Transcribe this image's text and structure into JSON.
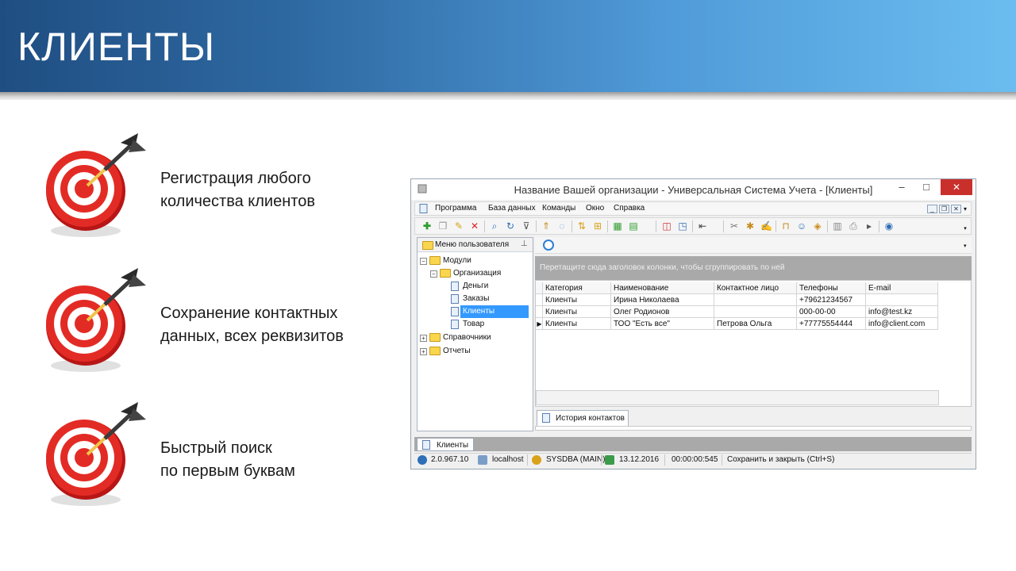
{
  "slide": {
    "title": "КЛИЕНТЫ",
    "features": [
      {
        "line1": "Регистрация любого",
        "line2": "количества клиентов"
      },
      {
        "line1": "Сохранение контактных",
        "line2": "данных, всех реквизитов"
      },
      {
        "line1": "Быстрый поиск",
        "line2": "по первым буквам"
      }
    ]
  },
  "window": {
    "title": "Название Вашей организации - Универсальная Система Учета - [Клиенты]",
    "controls": {
      "minimize": "–",
      "maximize": "□",
      "close": "✕"
    },
    "menu": [
      "Программа",
      "База данных",
      "Команды",
      "Окно",
      "Справка"
    ],
    "mdi_controls": {
      "minimize": "_",
      "restore": "❐",
      "close": "✕",
      "more": "▾"
    },
    "toolbar_more": "▾"
  },
  "left_panel": {
    "title": "Меню пользователя",
    "pin": "⊥",
    "tree": [
      {
        "label": "Модули",
        "expander": "−"
      },
      {
        "label": "Организация",
        "expander": "−"
      },
      {
        "label": "Деньги"
      },
      {
        "label": "Заказы"
      },
      {
        "label": "Клиенты"
      },
      {
        "label": "Товар"
      },
      {
        "label": "Справочники",
        "expander": "+"
      },
      {
        "label": "Отчеты",
        "expander": "+"
      }
    ]
  },
  "right_panel": {
    "dropdown": "▾",
    "group_hint": "Перетащите сюда заголовок колонки, чтобы сгруппировать по ней",
    "columns": [
      "Категория",
      "Наименование",
      "Контактное лицо",
      "Телефоны",
      "E-mail"
    ],
    "rows": [
      [
        "Клиенты",
        "Ирина Николаева",
        "",
        "+79621234567",
        ""
      ],
      [
        "Клиенты",
        "Олег Родионов",
        "",
        "000-00-00",
        "info@test.kz"
      ],
      [
        "Клиенты",
        "ТОО \"Есть все\"",
        "Петрова Ольга",
        "+77775554444",
        "info@client.com"
      ]
    ],
    "current_row_marker": "▶",
    "history_tab": "История контактов"
  },
  "doc_tab": "Клиенты",
  "status_bar": {
    "version": "2.0.967.10",
    "host": "localhost",
    "user": "SYSDBA (MAIN)",
    "date": "13.12.2016",
    "timer": "00:00:00:545",
    "hint": "Сохранить и закрыть (Ctrl+S)"
  },
  "colors": {
    "header_start": "#1f4e82",
    "header_end": "#6bbdf0",
    "close_button": "#c9302c",
    "selection": "#3399ff",
    "target_red": "#d8201f"
  }
}
